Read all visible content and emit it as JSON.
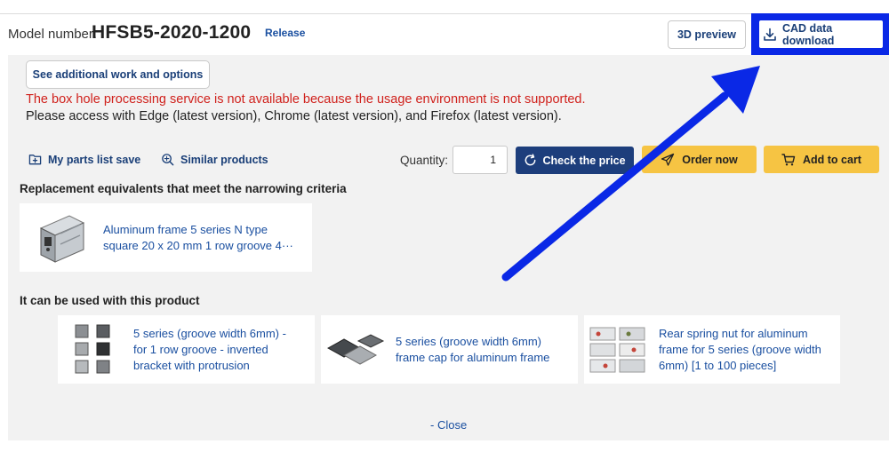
{
  "header": {
    "model_label": "Model number:",
    "model_number": "HFSB5-2020-1200",
    "release_label": "Release",
    "preview_label": "3D preview",
    "cad_label": "CAD data download"
  },
  "options": {
    "additional_label": "See additional work and options",
    "warning_red": "The box hole processing service is not available because the usage environment is not supported.",
    "warning_info": "Please access with Edge (latest version), Chrome (latest version), and Firefox (latest version)."
  },
  "actions": {
    "parts_list_label": "My parts list save",
    "similar_label": "Similar products",
    "quantity_label": "Quantity:",
    "quantity_value": "1",
    "check_price_label": "Check the price",
    "order_now_label": "Order now",
    "add_to_cart_label": "Add to cart"
  },
  "replacement": {
    "title": "Replacement equivalents that meet the narrowing criteria",
    "item_line1": "Aluminum frame 5 series N type",
    "item_line2": "square 20 x 20 mm 1 row groove 4···"
  },
  "related": {
    "title": "It can be used with this product",
    "items": [
      {
        "line1": "5 series (groove width 6mm) -",
        "line2": "for 1 row groove - inverted",
        "line3": "bracket with protrusion"
      },
      {
        "line1": "5 series (groove width 6mm)",
        "line2": "frame cap for aluminum frame",
        "line3": ""
      },
      {
        "line1": "Rear spring nut for aluminum",
        "line2": "frame for 5 series (groove width",
        "line3": "6mm) [1 to 100 pieces]"
      }
    ]
  },
  "footer": {
    "close_label": "- Close"
  },
  "colors": {
    "accent_blue": "#1a3f78",
    "link_blue": "#1a4fa0",
    "warning_red": "#d0211c",
    "cta_yellow": "#f6c443",
    "highlight_blue": "#0a28e6"
  },
  "icons": [
    "download-icon",
    "folder-plus-icon",
    "similar-search-icon",
    "refresh-icon",
    "order-plane-icon",
    "cart-icon",
    "annotation-arrow"
  ]
}
